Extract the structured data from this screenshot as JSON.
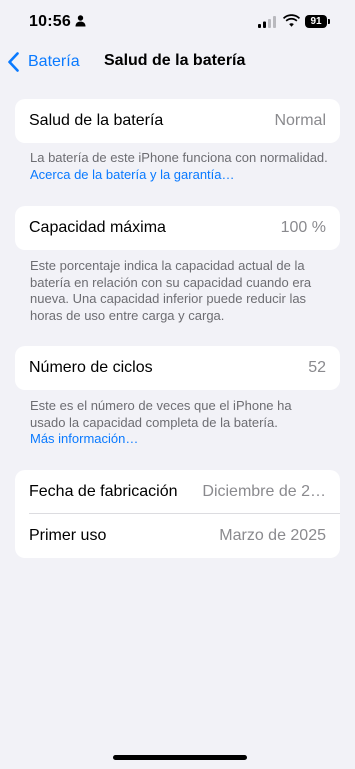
{
  "status_bar": {
    "time": "10:56",
    "battery_level": "91"
  },
  "nav": {
    "back_label": "Batería",
    "title": "Salud de la batería"
  },
  "health": {
    "label": "Salud de la batería",
    "value": "Normal",
    "footer_text": "La batería de este iPhone funciona con normalidad. ",
    "footer_link": "Acerca de la batería y la garantía…"
  },
  "capacity": {
    "label": "Capacidad máxima",
    "value": "100 %",
    "footer_text": "Este porcentaje indica la capacidad actual de la batería en relación con su capacidad cuando era nueva. Una capacidad inferior puede reducir las horas de uso entre carga y carga."
  },
  "cycles": {
    "label": "Número de ciclos",
    "value": "52",
    "footer_text": "Este es el número de veces que el iPhone ha usado la capacidad completa de la batería.",
    "footer_link": "Más información…"
  },
  "dates": {
    "manufacture_label": "Fecha de fabricación",
    "manufacture_value": "Diciembre de 2…",
    "first_use_label": "Primer uso",
    "first_use_value": "Marzo de 2025"
  },
  "colors": {
    "background": "#f2f2f7",
    "accent": "#0a7aff",
    "secondary_text": "#8a8a8e"
  }
}
